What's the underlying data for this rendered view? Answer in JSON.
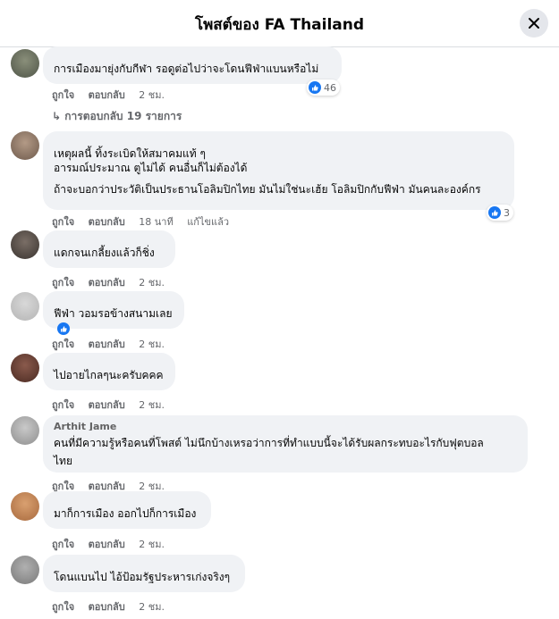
{
  "header": {
    "title": "โพสต์ของ FA Thailand"
  },
  "actions": {
    "like": "ถูกใจ",
    "reply": "ตอบกลับ"
  },
  "replies_link": "การตอบกลับ 19 รายการ",
  "comments": [
    {
      "name": "",
      "lines": [
        "การเมืองมายุ่งกับกีฬา รอดูต่อไปว่าจะโดนฟีฟ่าแบนหรือไม่"
      ],
      "time": "2 ชม.",
      "reactions": "46"
    },
    {
      "name": "",
      "lines": [
        "เหตุผลนี้ ทิ้งระเบิดให้สมาคมแท้ ๆ",
        "อารมณ์ประมาณ ตูไม่ได้ คนอื่นก็ไม่ต้องได้",
        "ถ้าจะบอกว่าประวัติเป็นประธานโอลิมปิกไทย มันไม่ใช่นะเฮ้ย โอลิมปิกกับฟีฟ่า มันคนละองค์กร"
      ],
      "time": "18 นาที",
      "edited": "แก้ไขแล้ว",
      "reactions": "3"
    },
    {
      "name": "",
      "lines": [
        "แดกจนเกลี้ยงแล้วก็ชิ่ง"
      ],
      "time": "2 ชม."
    },
    {
      "name": "",
      "lines": [
        "ฟีฟ่า วอมรอข้างสนามเลย"
      ],
      "time": "2 ชม.",
      "reactions": ""
    },
    {
      "name": "",
      "lines": [
        "ไปอายไกลๆนะครับคคค"
      ],
      "time": "2 ชม."
    },
    {
      "name": "Arthit Jame",
      "lines": [
        "คนที่มีความรู้หรือคนที่โพสต์ ไม่นึกบ้างเหรอว่าการที่ทำแบบนี้จะได้รับผลกระทบอะไรกับฟุตบอล",
        "ไทย"
      ],
      "time": "2 ชม."
    },
    {
      "name": "",
      "lines": [
        "มาก็การเมือง ออกไปก็การเมือง"
      ],
      "time": "2 ชม."
    },
    {
      "name": "",
      "lines": [
        "โดนแบนไป ไอ้ป้อมรัฐประหารเก่งจริงๆ"
      ],
      "time": "2 ชม."
    }
  ],
  "colors": {
    "like_blue": "#1877f2",
    "bubble": "#f0f2f5",
    "meta_grey": "#65676b"
  }
}
